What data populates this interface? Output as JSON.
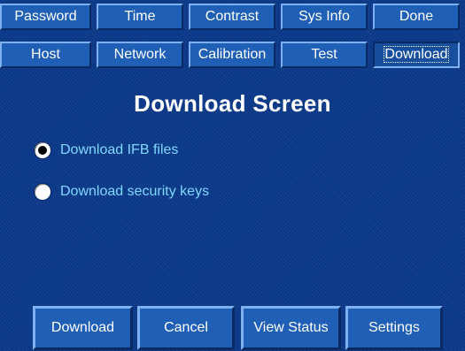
{
  "tabs": {
    "row1": [
      "Password",
      "Time",
      "Contrast",
      "Sys Info",
      "Done"
    ],
    "row2": [
      "Host",
      "Network",
      "Calibration",
      "Test",
      "Download"
    ]
  },
  "title": "Download Screen",
  "options": [
    {
      "label": "Download IFB files",
      "selected": true
    },
    {
      "label": "Download security keys",
      "selected": false
    }
  ],
  "buttons": {
    "download": "Download",
    "cancel": "Cancel",
    "view_status": "View Status",
    "settings": "Settings"
  },
  "colors": {
    "background": "#0b3a8c",
    "tab_face": "#1f5fb6",
    "option_text": "#7fd8ff",
    "text": "#ffffff"
  }
}
